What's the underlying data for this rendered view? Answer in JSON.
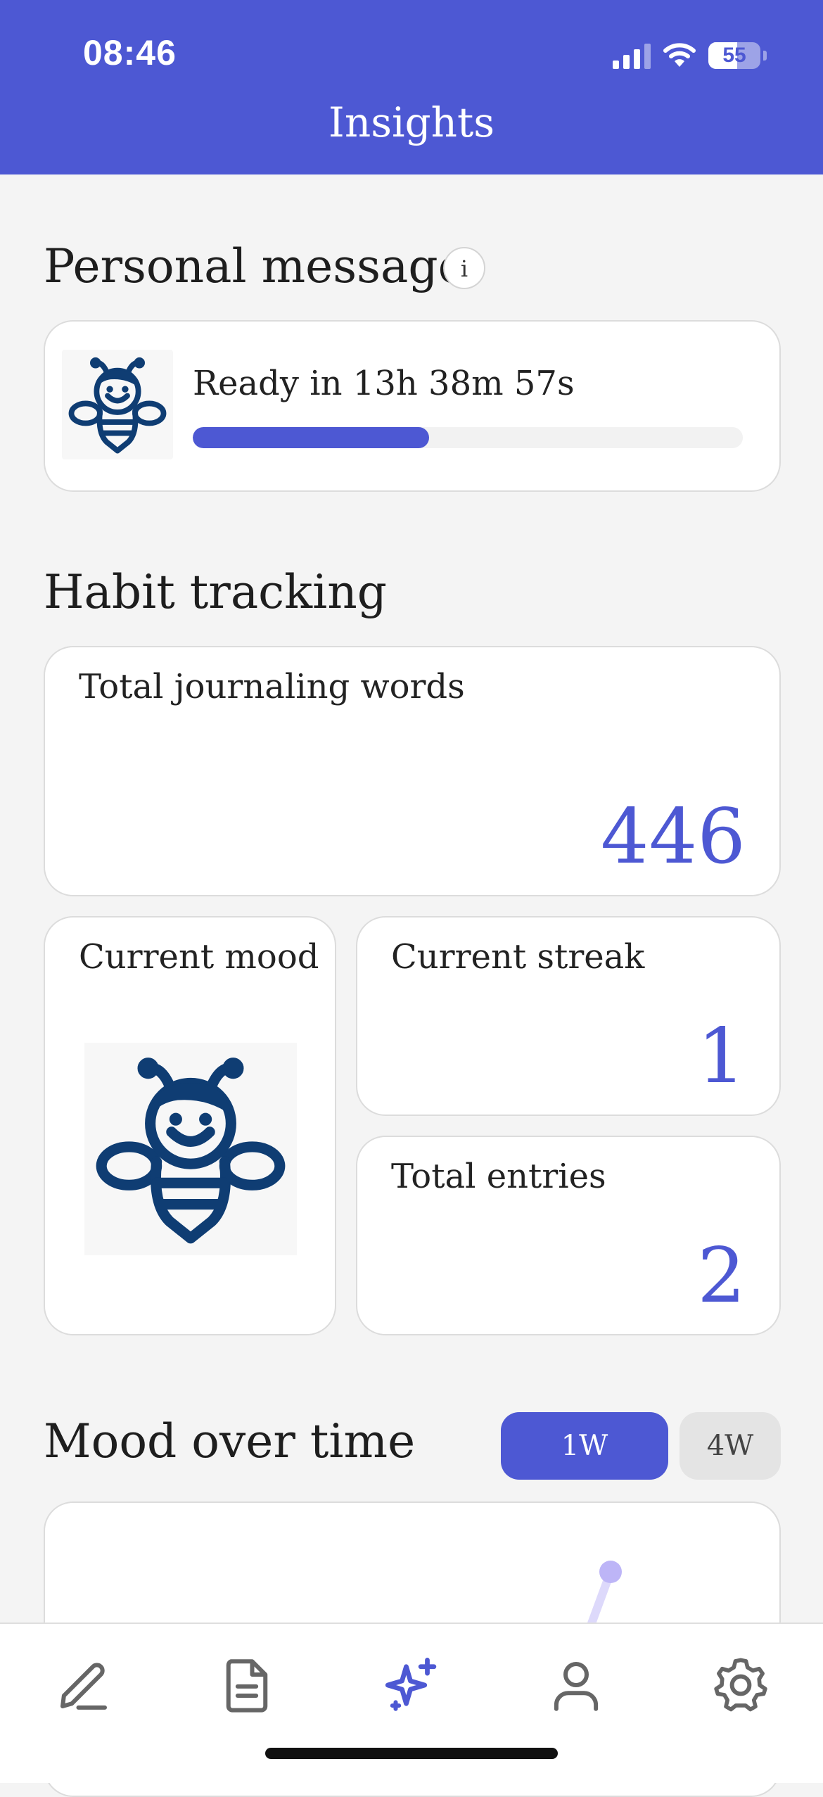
{
  "status_bar": {
    "time": "08:46",
    "battery": "55"
  },
  "header": {
    "title": "Insights"
  },
  "personal_message": {
    "title": "Personal message",
    "info_label": "i",
    "ready_text": "Ready in 13h 38m 57s",
    "progress": 0.43
  },
  "habit_tracking": {
    "title": "Habit tracking",
    "total_words": {
      "label": "Total journaling words",
      "value": "446"
    },
    "current_mood": {
      "label": "Current mood"
    },
    "current_streak": {
      "label": "Current streak",
      "value": "1"
    },
    "total_entries": {
      "label": "Total entries",
      "value": "2"
    }
  },
  "mood_over_time": {
    "title": "Mood over time",
    "range_options": [
      "1W",
      "4W"
    ],
    "selected": "1W"
  },
  "tab_bar": {
    "items": [
      "write-icon",
      "entries-icon",
      "insights-icon",
      "profile-icon",
      "settings-icon"
    ],
    "active": "insights-icon"
  },
  "colors": {
    "accent": "#4d58d3",
    "background": "#f4f4f4",
    "bee": "#0f3d73"
  }
}
